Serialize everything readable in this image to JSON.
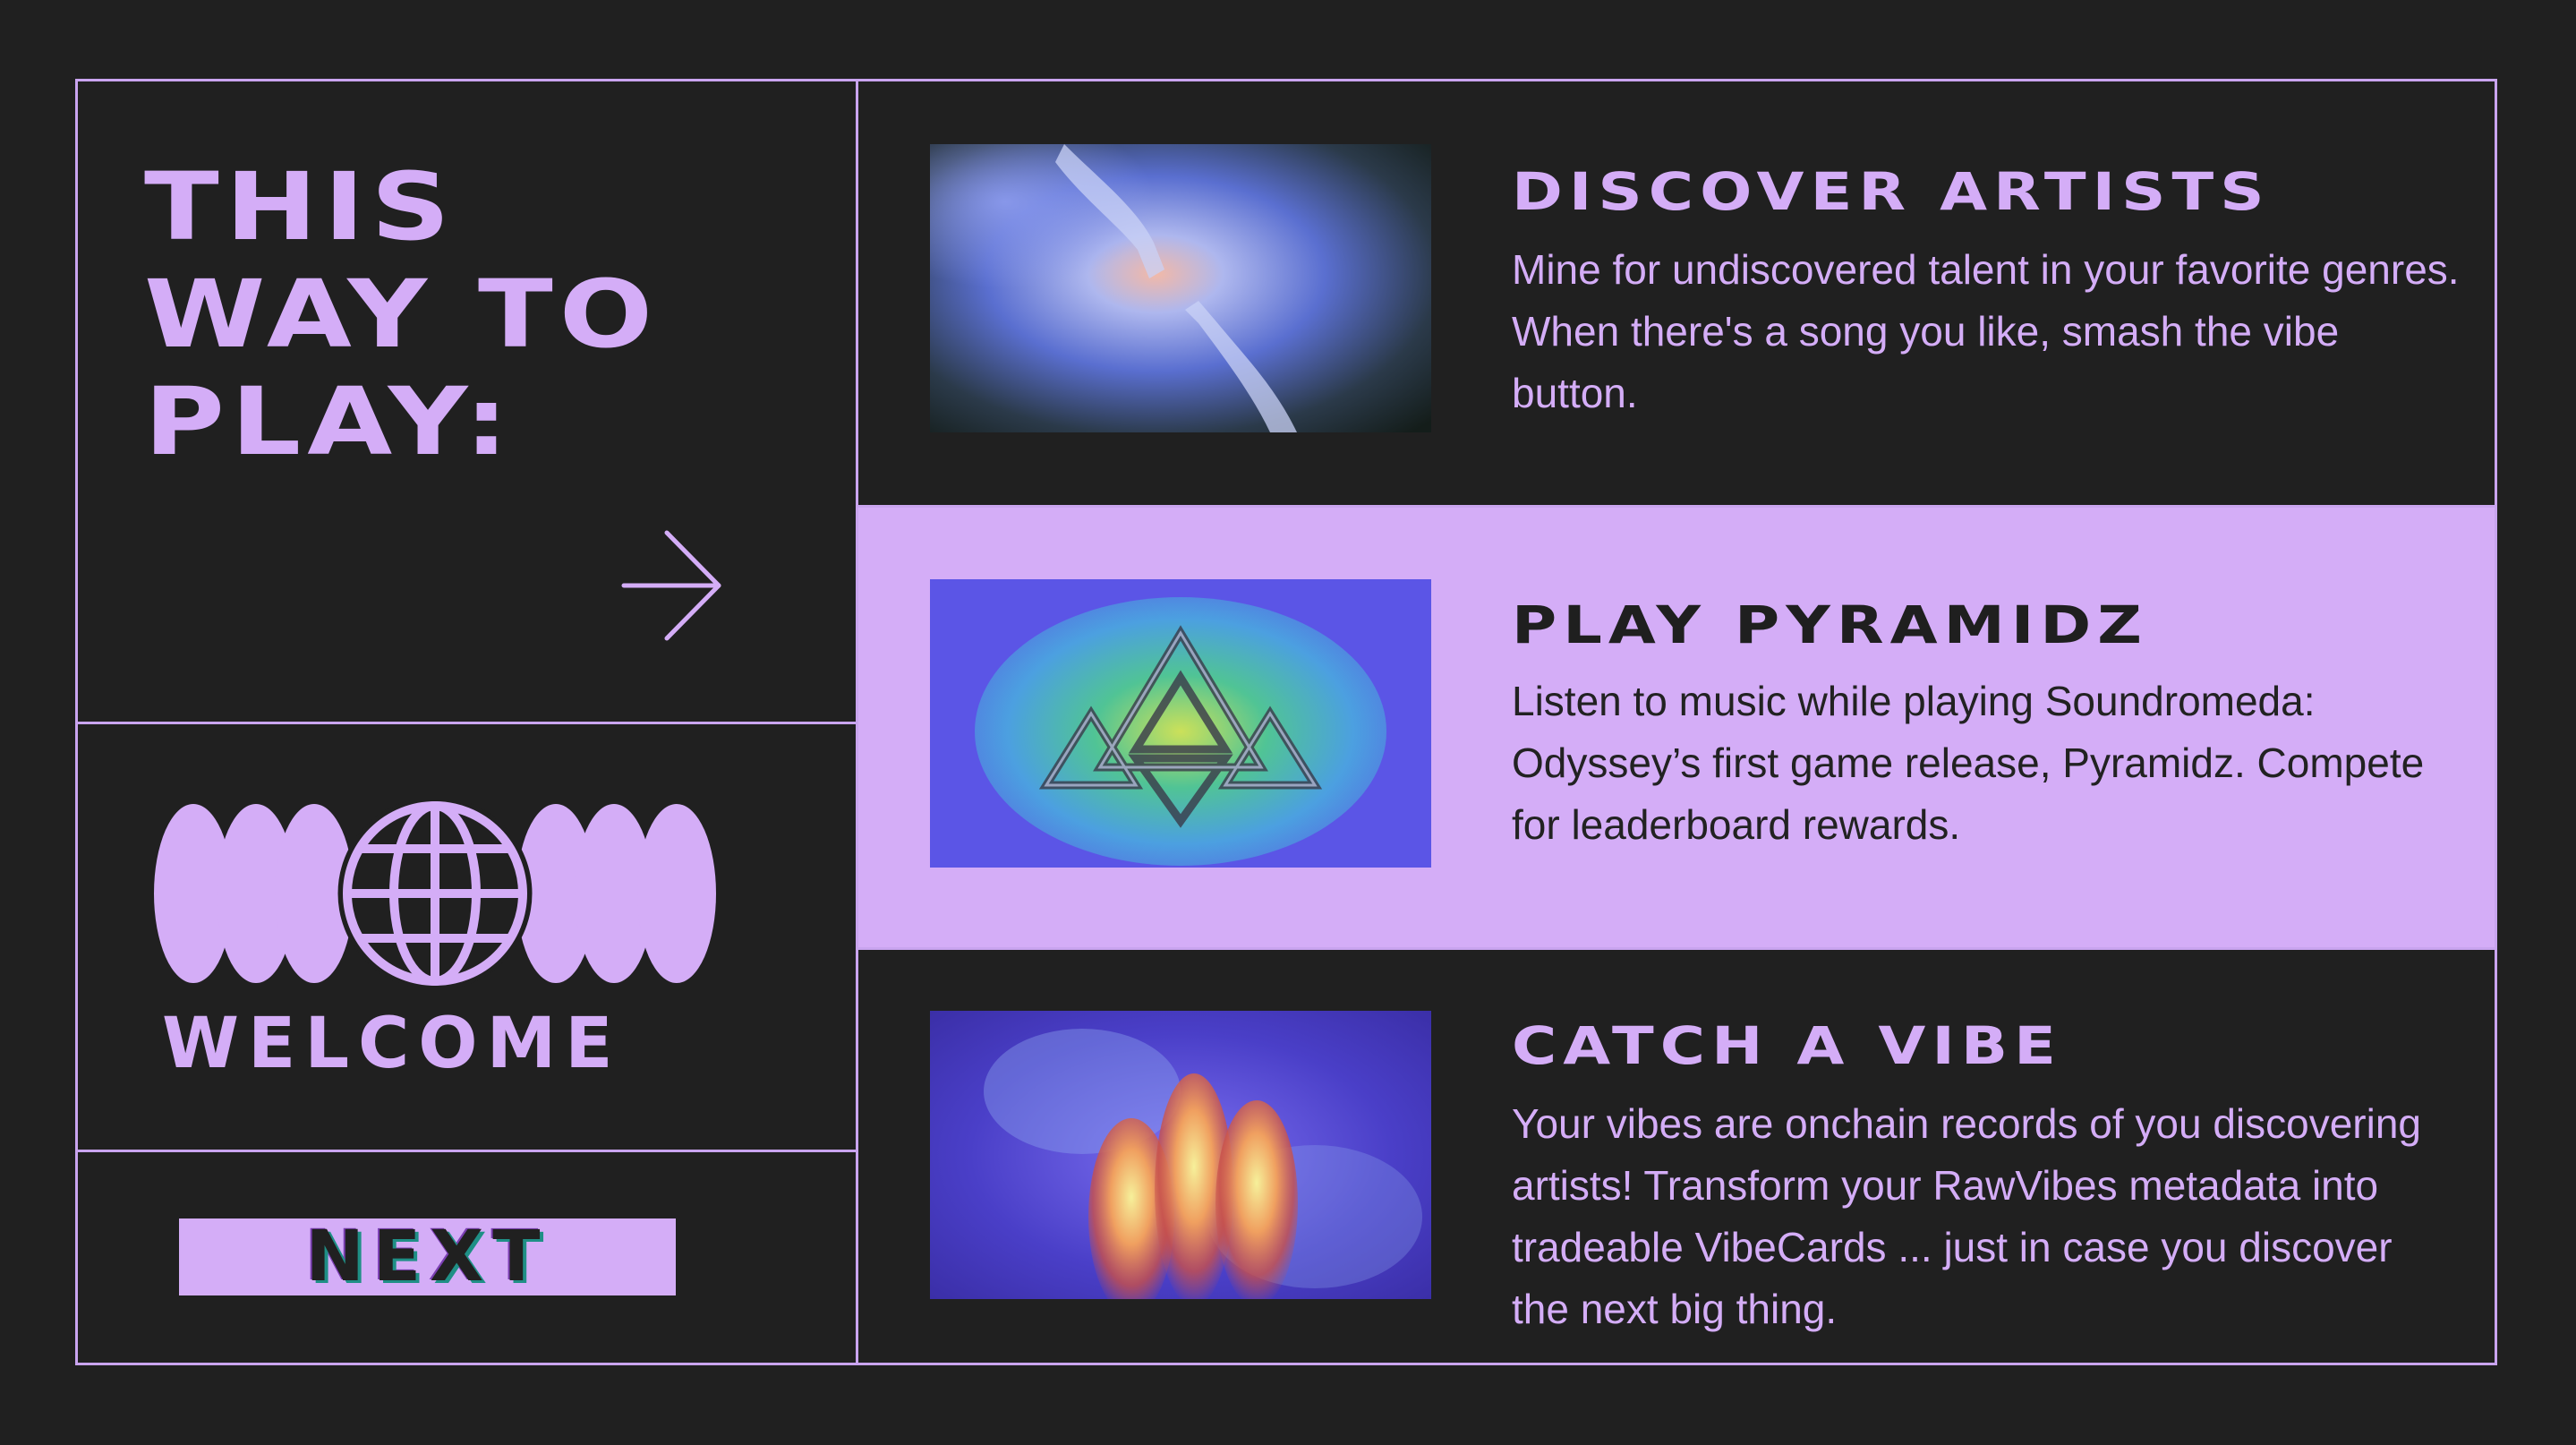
{
  "left_panel": {
    "title_lines": [
      "THIS",
      "WAY TO",
      "PLAY:"
    ],
    "arrow_icon": "arrow-right-icon",
    "welcome_label": "WELCOME",
    "globe_icon": "globe-icon",
    "next_button_label": "NEXT"
  },
  "cards": [
    {
      "heading": "DISCOVER ARTISTS",
      "description": "Mine for undiscovered talent in your favorite genres. When there's a song you like, smash the vibe button.",
      "image_icon": "reaching-hands-image"
    },
    {
      "heading": "PLAY PYRAMIDZ",
      "description": "Listen to music while playing Soundromeda: Odyssey’s first game release, Pyramidz. Compete for leaderboard rewards.",
      "image_icon": "pyramid-logo-image"
    },
    {
      "heading": "CATCH A VIBE",
      "description": "Your vibes are onchain records of you discovering artists! Transform your RawVibes metadata into tradeable VibeCards ... just in case you discover the next big thing.",
      "image_icon": "blurred-figures-image"
    }
  ],
  "colors": {
    "background": "#202020",
    "accent": "#d4adf7",
    "border": "#c9a4ef"
  }
}
